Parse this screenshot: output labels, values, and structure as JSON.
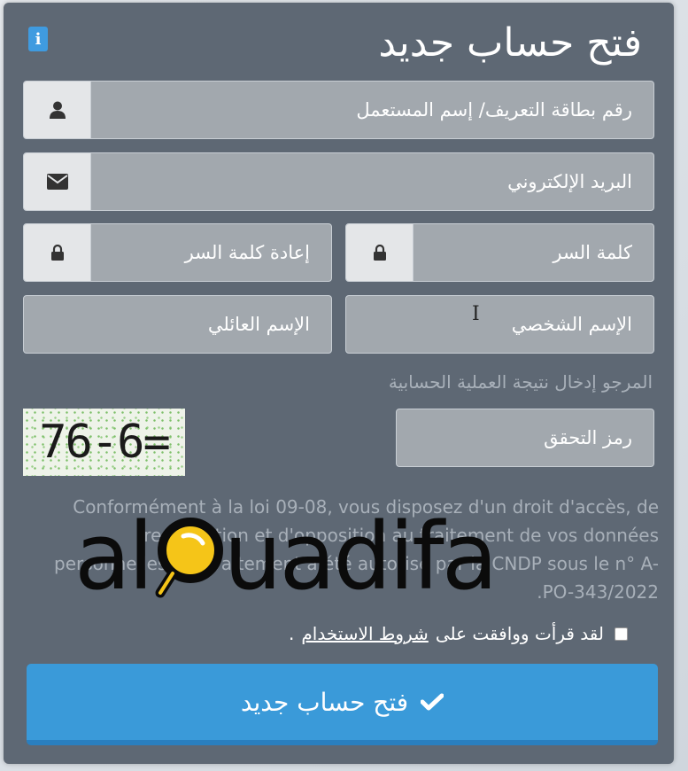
{
  "title": "فتح حساب جديد",
  "fields": {
    "username": "رقم بطاقة التعريف/ إسم المستعمل",
    "email": "البريد الإلكتروني",
    "password": "كلمة السر",
    "password_confirm": "إعادة كلمة السر",
    "first_name": "الإسم الشخصي",
    "last_name": "الإسم العائلي",
    "captcha": "رمز التحقق"
  },
  "captcha_hint": "المرجو إدخال نتيجة العملية الحسابية",
  "captcha_image_text": "76-6=",
  "legal_lines": [
    "Conformément à la loi 09-08, vous disposez d'un droit d'accès, de",
    "rectification et d'opposition au traitement de vos données",
    "personnelles. Ce traitement a été autorisé par la CNDP sous le n° A-",
    ".PO-343/2022"
  ],
  "agree": {
    "prefix": "لقد قرأت ووافقت على",
    "link": "شروط الاستخدام",
    "suffix": "."
  },
  "submit_label": "فتح حساب جديد",
  "watermark": {
    "pre": "al",
    "post": "uadifa"
  },
  "colors": {
    "card": "#5e6874",
    "field": "#a2a8ae",
    "addon": "#e4e6e8",
    "accent": "#3a9ad9",
    "info": "#3f9be0",
    "magnifier": "#f5c518"
  }
}
